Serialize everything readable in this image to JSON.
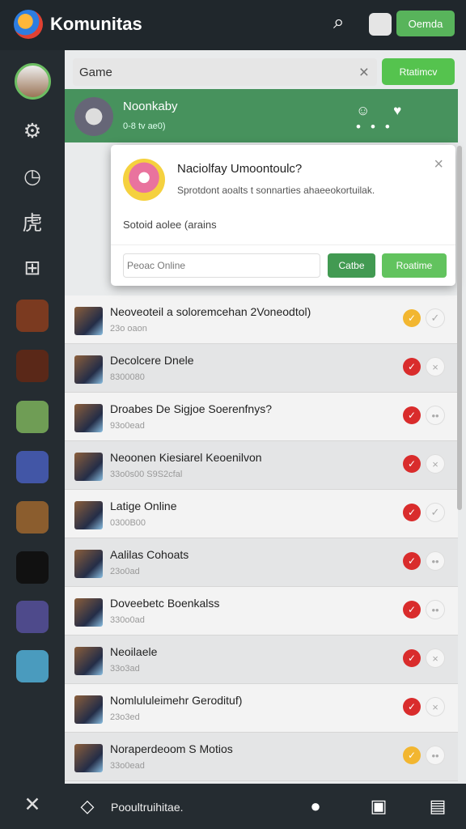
{
  "app": {
    "title": "Komunitas",
    "top_button": "Oemda"
  },
  "search": {
    "value": "Game",
    "button": "Rtatimcv"
  },
  "featured": {
    "title": "Noonkaby",
    "subtitle": "0-8 tv ae0)"
  },
  "dialog": {
    "title": "Naciolfay Umoontoulc?",
    "description": "Sprotdont aoalts t sonnarties ahaeeokortuilak.",
    "field_label": "Sotoid aolee (arains",
    "input_value": "Peoac Online",
    "cancel_label": "Catbe",
    "ok_label": "Roatime"
  },
  "rows": [
    {
      "name": "Neoveoteil a soloremcehan 2Voneodtol)",
      "sub": "23o oaon",
      "check": "yellow",
      "action": "✓"
    },
    {
      "name": "Decolcere Dnele",
      "sub": "8300080",
      "check": "red",
      "action": "×"
    },
    {
      "name": "Droabes De Sigjoe Soerenfnys?",
      "sub": "93o0ead",
      "check": "red",
      "action": "••"
    },
    {
      "name": "Neoonen Kiesiarel Keoenilvon",
      "sub": "33o0s00 S9S2cfal",
      "check": "red",
      "action": "×"
    },
    {
      "name": "Latige Online",
      "sub": "0300B00",
      "check": "red",
      "action": "✓"
    },
    {
      "name": "Aalilas Cohoats",
      "sub": "23o0ad",
      "check": "red",
      "action": "••"
    },
    {
      "name": "Doveebetc Boenkalss",
      "sub": "330o0ad",
      "check": "red",
      "action": "••"
    },
    {
      "name": "Neoilaele",
      "sub": "33o3ad",
      "check": "red",
      "action": "×"
    },
    {
      "name": "Nomlululeimehr Gerodituf)",
      "sub": "23o3ed",
      "check": "red",
      "action": "×"
    },
    {
      "name": "Noraperdeoom S Motios",
      "sub": "33o0ead",
      "check": "yellow",
      "action": "••"
    }
  ],
  "bottom": {
    "label": "Pooultruihitae."
  },
  "colors": {
    "green": "#58b45b",
    "red": "#d92c2c",
    "yellow": "#f2b630"
  }
}
